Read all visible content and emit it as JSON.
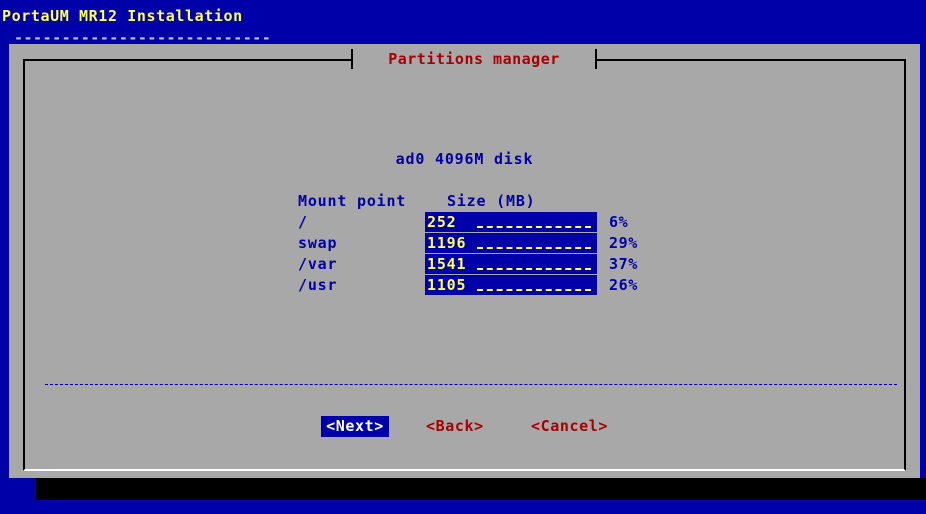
{
  "app": {
    "title": "PortaUM MR12 Installation",
    "title_underline": "---------------------------"
  },
  "dialog": {
    "title": "Partitions manager",
    "disk_label": "ad0 4096M disk",
    "columns": {
      "mount_point": "Mount point",
      "size": "Size (MB)"
    },
    "rows": [
      {
        "mount": "/",
        "size": "252",
        "percent": "6%"
      },
      {
        "mount": "swap",
        "size": "1196",
        "percent": "29%"
      },
      {
        "mount": "/var",
        "size": "1541",
        "percent": "37%"
      },
      {
        "mount": "/usr",
        "size": "1105",
        "percent": "26%"
      }
    ],
    "buttons": {
      "next": "<Next>",
      "back": "<Back>",
      "cancel": "<Cancel>"
    }
  },
  "colors": {
    "background": "#0000a8",
    "dialog": "#a8a8a8",
    "title_text": "#ffff55",
    "dialog_title": "#a80000",
    "label_text": "#0000a8",
    "field_bg": "#0000a8",
    "field_text": "#ffff55"
  }
}
